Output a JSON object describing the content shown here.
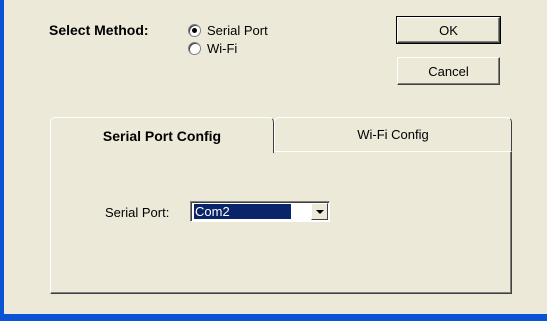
{
  "dialog": {
    "method_label": "Select Method:",
    "methods": [
      {
        "label": "Serial Port",
        "checked": true
      },
      {
        "label": "Wi-Fi",
        "checked": false
      }
    ],
    "ok_label": "OK",
    "cancel_label": "Cancel"
  },
  "tabs": [
    {
      "label": "Serial Port Config",
      "active": true
    },
    {
      "label": "Wi-Fi Config",
      "active": false
    }
  ],
  "serial_config": {
    "port_label": "Serial Port:",
    "port_value": "Com2"
  },
  "colors": {
    "background": "#ece9d8",
    "frame": "#0a53d4",
    "selection": "#0a246a"
  }
}
